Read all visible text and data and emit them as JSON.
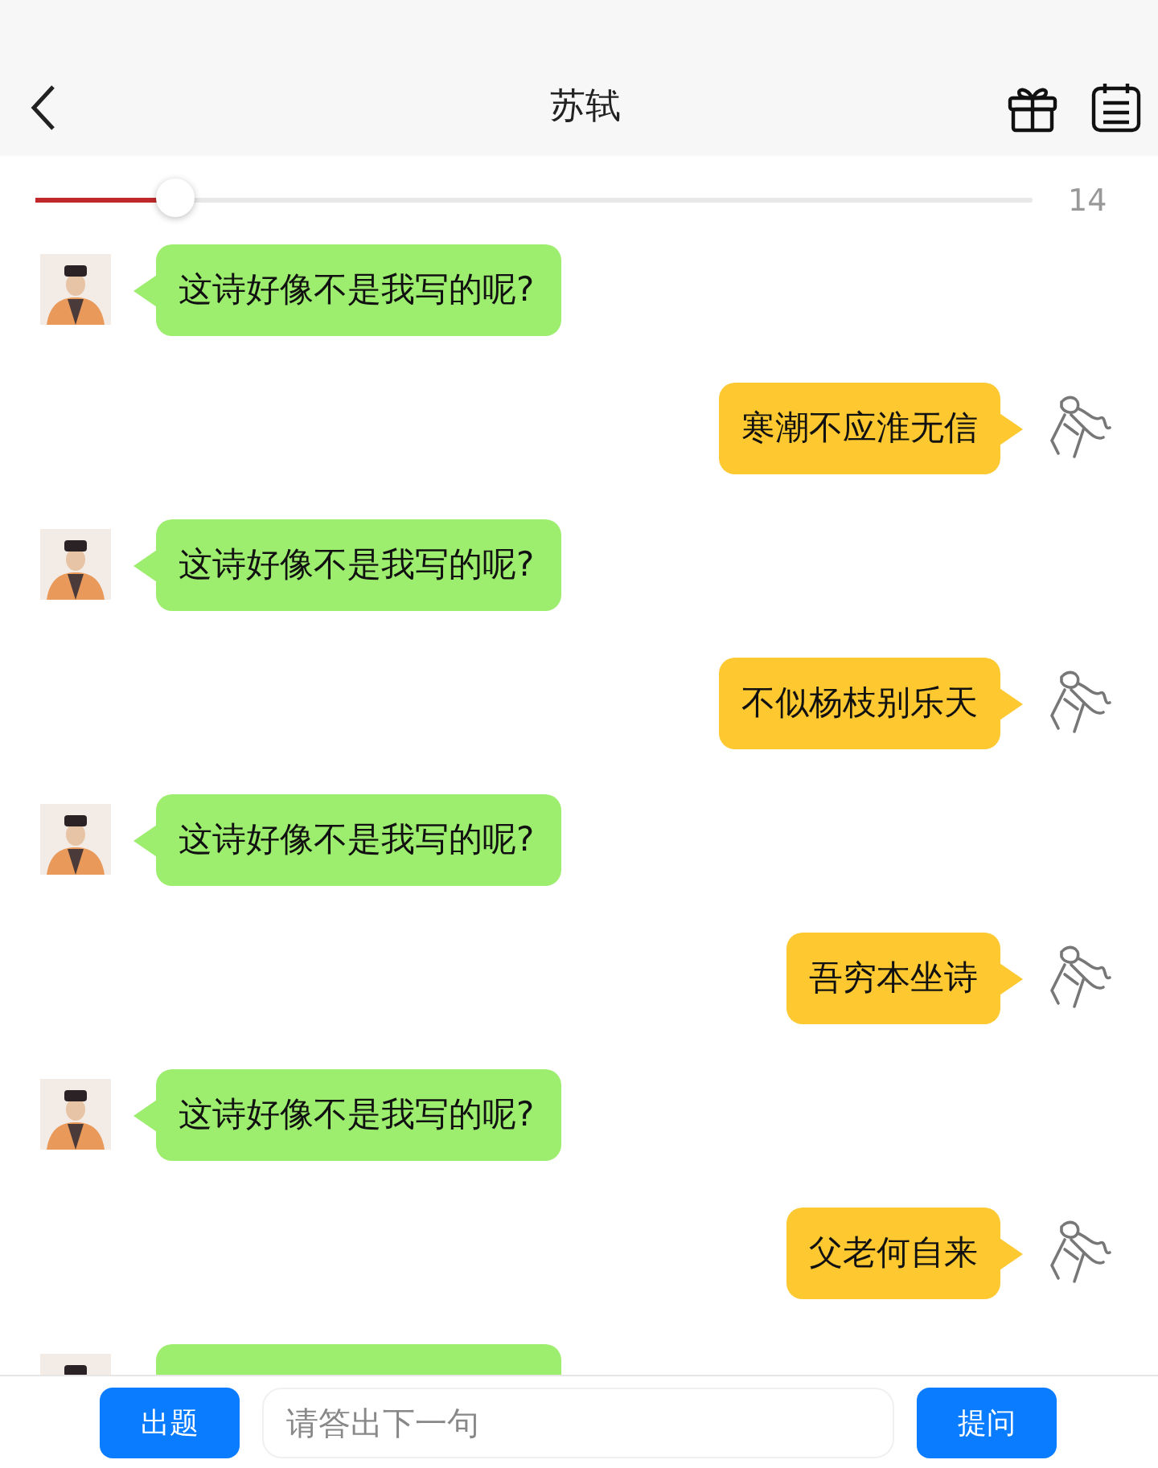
{
  "header": {
    "title": "苏轼"
  },
  "progress": {
    "level": 0.14,
    "reading": "14"
  },
  "messages": [
    {
      "kind": "bot",
      "text": "这诗好像不是我写的呢?"
    },
    {
      "kind": "user",
      "text": "寒潮不应淮无信"
    },
    {
      "kind": "bot",
      "text": "这诗好像不是我写的呢?"
    },
    {
      "kind": "user",
      "text": "不似杨枝别乐天"
    },
    {
      "kind": "bot",
      "text": "这诗好像不是我写的呢?"
    },
    {
      "kind": "user",
      "text": "吾穷本坐诗"
    },
    {
      "kind": "bot",
      "text": "这诗好像不是我写的呢?"
    },
    {
      "kind": "user",
      "text": "父老何自来"
    },
    {
      "kind": "bot"
    }
  ],
  "input_bar": {
    "left_button": "出题",
    "placeholder": "请答出下一句",
    "right_button": "提问"
  }
}
